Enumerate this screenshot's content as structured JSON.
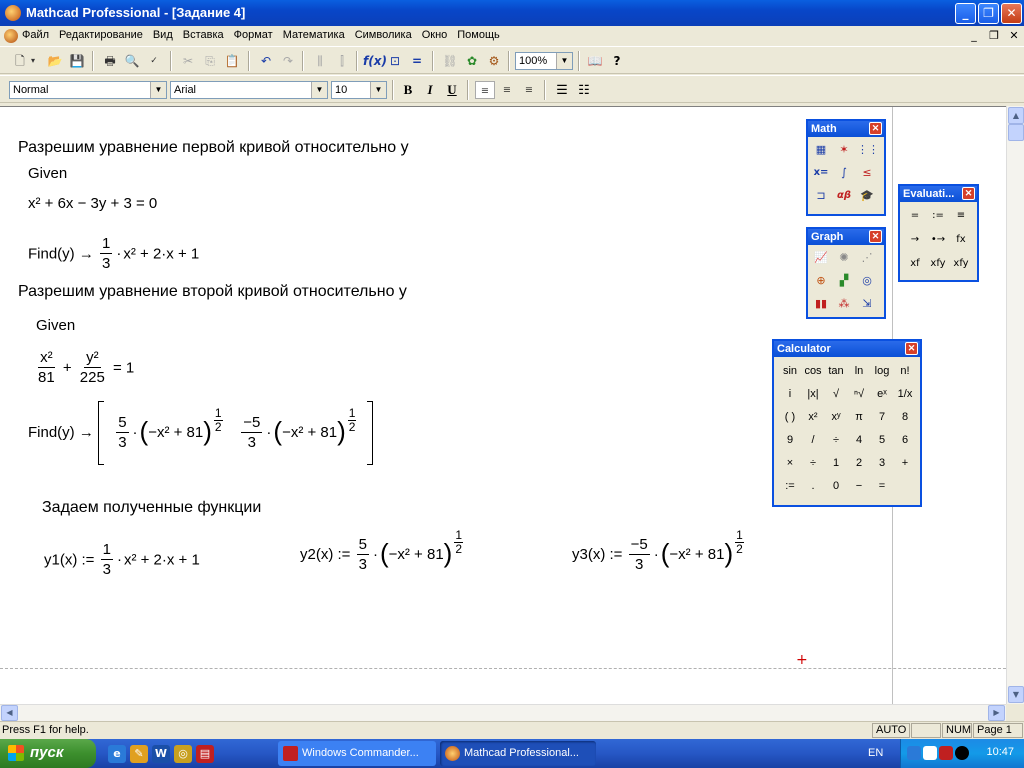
{
  "window": {
    "title": "Mathcad Professional - [Задание 4]",
    "minimize_icon": "minimize-icon",
    "maximize_icon": "restore-icon",
    "close_icon": "close-icon"
  },
  "menu": {
    "items": [
      "Файл",
      "Редактирование",
      "Вид",
      "Вставка",
      "Формат",
      "Математика",
      "Символика",
      "Окно",
      "Помощь"
    ]
  },
  "format_toolbar": {
    "style": "Normal",
    "font": "Arial",
    "size": "10",
    "zoom": "100%",
    "bold": "B",
    "italic": "I",
    "underline": "U"
  },
  "worksheet": {
    "heading1": "Разрешим уравнение первой кривой относительно у",
    "given1": "Given",
    "eq1_text": "x² + 6x − 3y + 3 = 0",
    "find1_prefix": "Find(y) →",
    "find1_n": "1",
    "find1_d": "3",
    "find1_rest": "x² + 2·x + 1",
    "heading2": "Разрешим уравнение второй кривой относительно у",
    "given2": "Given",
    "eq2_f1n": "x²",
    "eq2_f1d": "81",
    "eq2_f2n": "y²",
    "eq2_f2d": "225",
    "eq2_rest": "= 1",
    "find2_prefix": "Find(y) →",
    "find2_a_n": "5",
    "find2_a_d": "3",
    "find2_b_n": "−5",
    "find2_b_d": "3",
    "find2_inner": "−x² + 81",
    "half_n": "1",
    "half_d": "2",
    "heading3": "Задаем полученные функции",
    "y1_prefix": "y1(x) :=",
    "y1_n": "1",
    "y1_d": "3",
    "y1_rest": "x² + 2·x + 1",
    "y2_prefix": "y2(x) :=",
    "y2_n": "5",
    "y2_d": "3",
    "y3_prefix": "y3(x) :=",
    "y3_n": "−5",
    "y3_d": "3",
    "inner": "−x² + 81"
  },
  "palettes": {
    "math_title": "Math",
    "graph_title": "Graph",
    "eval_title": "Evaluati...",
    "calc_title": "Calculator",
    "eval_buttons": [
      "=",
      ":=",
      "≡",
      "→",
      "•→",
      "fx",
      "xf",
      "xfy",
      "xfy"
    ],
    "calc_buttons": [
      "sin",
      "cos",
      "tan",
      "ln",
      "log",
      "n!",
      "i",
      "|x|",
      "√",
      "ⁿ√",
      "eˣ",
      "1/x",
      "( )",
      "x²",
      "xʸ",
      "π",
      "7",
      "8",
      "9",
      "/",
      "÷",
      "4",
      "5",
      "6",
      "×",
      "÷",
      "1",
      "2",
      "3",
      "+",
      ":=",
      ".",
      "0",
      "−",
      "="
    ]
  },
  "statusbar": {
    "help": "Press F1 for help.",
    "auto": "AUTO",
    "num": "NUM",
    "page": "Page 1"
  },
  "taskbar": {
    "start": "пуск",
    "task1": "Windows Commander...",
    "task2": "Mathcad Professional...",
    "lang": "EN",
    "clock": "10:47"
  }
}
